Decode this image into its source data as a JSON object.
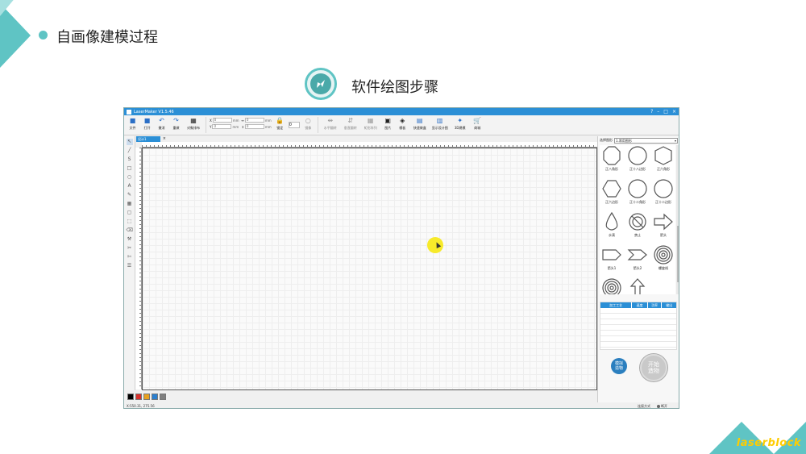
{
  "slide": {
    "title": "自画像建模过程",
    "subtitle": "软件绘图步骤",
    "logo_text": "laserblock"
  },
  "app": {
    "window_title": "LaserMaker V1.5.46",
    "window_buttons": [
      "?",
      "–",
      "□",
      "×"
    ],
    "toolbar": {
      "file": "文件",
      "open": "打开",
      "undo": "撤消",
      "redo": "重做",
      "object_align": "对象排布",
      "field_x": "0",
      "field_y": "0",
      "field_w": "0",
      "field_h": "0",
      "unit": "mm",
      "lock": "锁定",
      "rotate_value": "0",
      "mirror": "镜像",
      "h_flip": "水平翻转",
      "v_flip": "垂直翻转",
      "array": "矩形阵列",
      "image": "图片",
      "model": "模板",
      "quick_box": "快速做盒",
      "show_design": "显示设计图",
      "model_3d": "3D建模",
      "shop": "商城"
    },
    "doc_tab": "设计1",
    "colors": [
      "#000000",
      "#d9302c",
      "#e8a11e",
      "#2b7fcf",
      "#7f7f7f"
    ],
    "status_left": "X:550.31, 275.56",
    "status_connect": "连接方式",
    "status_state": "断开",
    "right_panel": {
      "select_label": "选择图形",
      "select_value": "1.常用图形",
      "shapes": [
        {
          "label": "正八角形",
          "kind": "octagon"
        },
        {
          "label": "正十八边形",
          "kind": "circle"
        },
        {
          "label": "正六角形",
          "kind": "hexagon"
        },
        {
          "label": "正六边形",
          "kind": "hexagon2"
        },
        {
          "label": "正十二角形",
          "kind": "circle"
        },
        {
          "label": "正十二边形",
          "kind": "circle2"
        },
        {
          "label": "水滴",
          "kind": "drop"
        },
        {
          "label": "禁止",
          "kind": "ban"
        },
        {
          "label": "箭头",
          "kind": "arrow"
        },
        {
          "label": "箭头1",
          "kind": "pentagon-arrow"
        },
        {
          "label": "箭头2",
          "kind": "chevron"
        },
        {
          "label": "螺旋线",
          "kind": "spiral"
        },
        {
          "label": "",
          "kind": "spiral2"
        },
        {
          "label": "",
          "kind": "up-arrow"
        }
      ],
      "proc_headers": [
        "加工工艺",
        "速度",
        "功率",
        "输出"
      ],
      "simulate_label": "模拟\n造物",
      "start_label": "开始\n造物"
    }
  }
}
